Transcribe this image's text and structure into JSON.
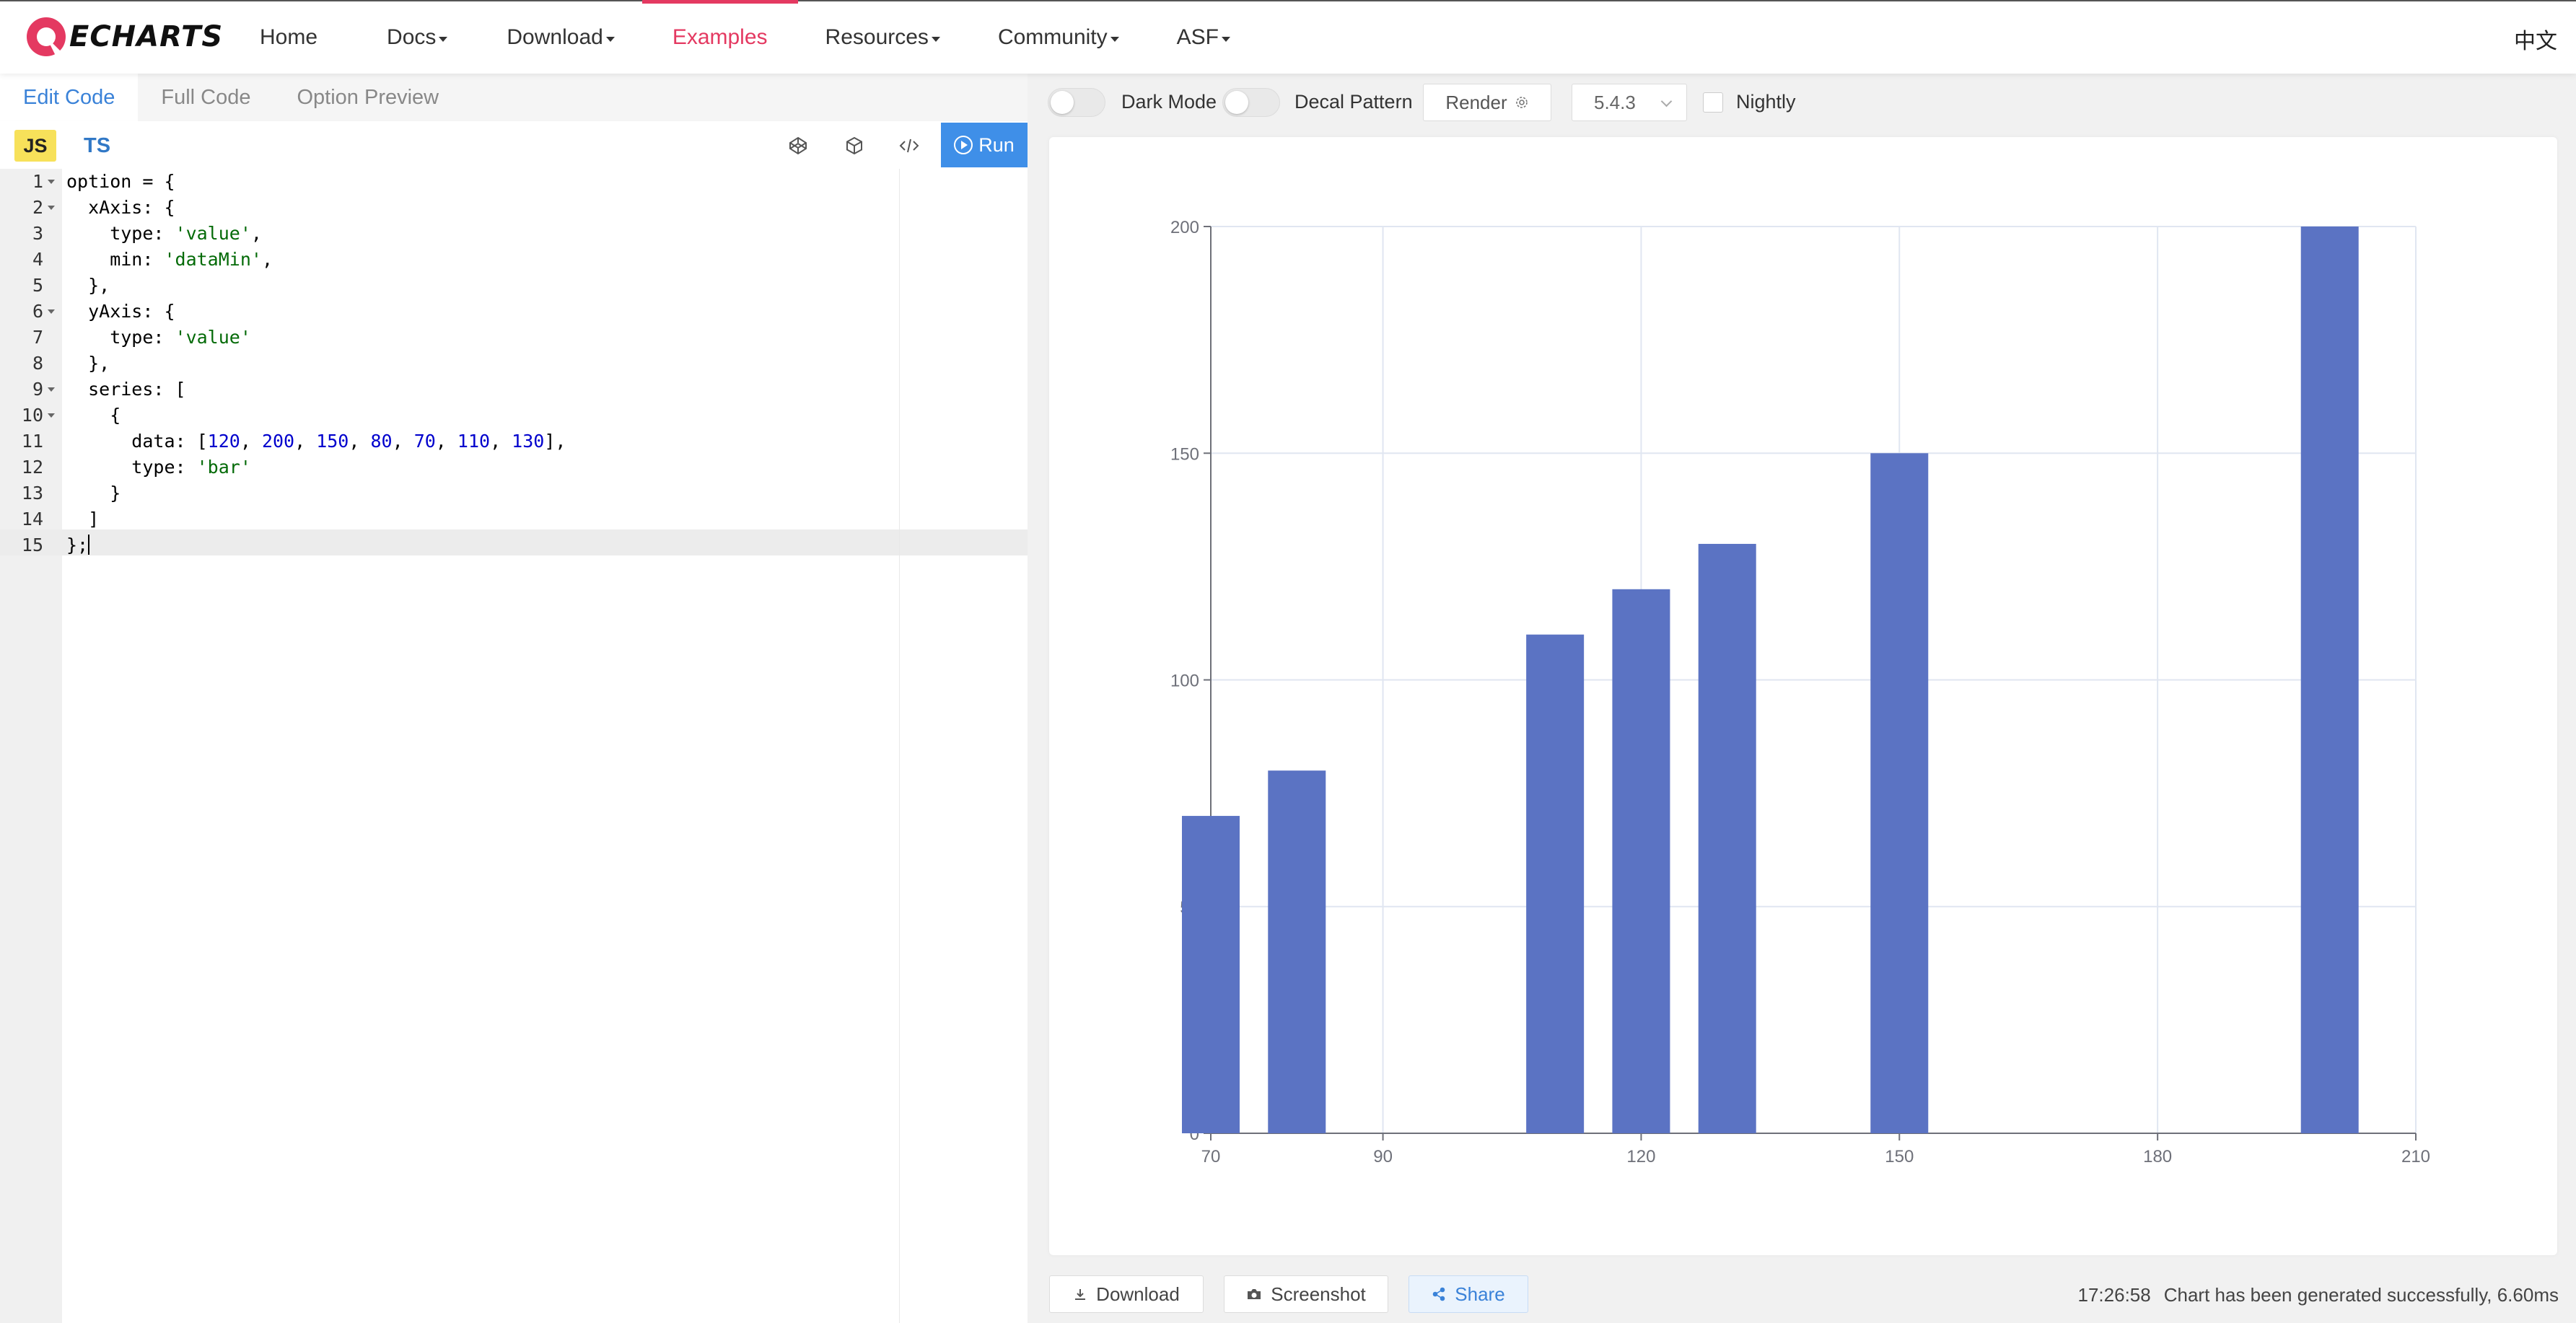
{
  "navbar": {
    "logo_text": "ECHARTS",
    "items": [
      {
        "label": "Home",
        "has_caret": false
      },
      {
        "label": "Docs",
        "has_caret": true
      },
      {
        "label": "Download",
        "has_caret": true
      },
      {
        "label": "Examples",
        "has_caret": false,
        "active": true
      },
      {
        "label": "Resources",
        "has_caret": true
      },
      {
        "label": "Community",
        "has_caret": true
      },
      {
        "label": "ASF",
        "has_caret": true
      }
    ],
    "language": "中文",
    "accent_color": "#e43961"
  },
  "editor": {
    "tabs": [
      "Edit Code",
      "Full Code",
      "Option Preview"
    ],
    "active_tab": "Edit Code",
    "lang_js": "JS",
    "lang_ts": "TS",
    "run_label": "Run",
    "tool_icons": [
      "codepen-icon",
      "codesandbox-icon",
      "code-embed-icon"
    ],
    "lines": [
      {
        "n": "1",
        "fold": true
      },
      {
        "n": "2",
        "fold": true
      },
      {
        "n": "3",
        "fold": false
      },
      {
        "n": "4",
        "fold": false
      },
      {
        "n": "5",
        "fold": false
      },
      {
        "n": "6",
        "fold": true
      },
      {
        "n": "7",
        "fold": false
      },
      {
        "n": "8",
        "fold": false
      },
      {
        "n": "9",
        "fold": true
      },
      {
        "n": "10",
        "fold": true
      },
      {
        "n": "11",
        "fold": false
      },
      {
        "n": "12",
        "fold": false
      },
      {
        "n": "13",
        "fold": false
      },
      {
        "n": "14",
        "fold": false
      },
      {
        "n": "15",
        "fold": false
      }
    ],
    "code": [
      [
        {
          "t": "option = {",
          "c": ""
        }
      ],
      [
        {
          "t": "  xAxis: {",
          "c": ""
        }
      ],
      [
        {
          "t": "    type: ",
          "c": ""
        },
        {
          "t": "'value'",
          "c": "s"
        },
        {
          "t": ",",
          "c": ""
        }
      ],
      [
        {
          "t": "    min: ",
          "c": ""
        },
        {
          "t": "'dataMin'",
          "c": "s"
        },
        {
          "t": ",",
          "c": ""
        }
      ],
      [
        {
          "t": "  },",
          "c": ""
        }
      ],
      [
        {
          "t": "  yAxis: {",
          "c": ""
        }
      ],
      [
        {
          "t": "    type: ",
          "c": ""
        },
        {
          "t": "'value'",
          "c": "s"
        }
      ],
      [
        {
          "t": "  },",
          "c": ""
        }
      ],
      [
        {
          "t": "  series: [",
          "c": ""
        }
      ],
      [
        {
          "t": "    {",
          "c": ""
        }
      ],
      [
        {
          "t": "      data: [",
          "c": ""
        },
        {
          "t": "120",
          "c": "n"
        },
        {
          "t": ", ",
          "c": ""
        },
        {
          "t": "200",
          "c": "n"
        },
        {
          "t": ", ",
          "c": ""
        },
        {
          "t": "150",
          "c": "n"
        },
        {
          "t": ", ",
          "c": ""
        },
        {
          "t": "80",
          "c": "n"
        },
        {
          "t": ", ",
          "c": ""
        },
        {
          "t": "70",
          "c": "n"
        },
        {
          "t": ", ",
          "c": ""
        },
        {
          "t": "110",
          "c": "n"
        },
        {
          "t": ", ",
          "c": ""
        },
        {
          "t": "130",
          "c": "n"
        },
        {
          "t": "],",
          "c": ""
        }
      ],
      [
        {
          "t": "      type: ",
          "c": ""
        },
        {
          "t": "'bar'",
          "c": "s"
        }
      ],
      [
        {
          "t": "    }",
          "c": ""
        }
      ],
      [
        {
          "t": "  ]",
          "c": ""
        }
      ],
      [
        {
          "t": "};",
          "c": ""
        }
      ]
    ]
  },
  "toolbar": {
    "dark_mode_label": "Dark Mode",
    "decal_label": "Decal Pattern",
    "render_label": "Render",
    "version": "5.4.3",
    "nightly_label": "Nightly"
  },
  "chart_data": {
    "type": "bar",
    "bar_color": "#5b73c3",
    "x": [
      120,
      200,
      150,
      80,
      70,
      110,
      130
    ],
    "values": [
      120,
      200,
      150,
      80,
      70,
      110,
      130
    ],
    "xlim": [
      70,
      210
    ],
    "ylim": [
      0,
      200
    ],
    "x_ticks": [
      "70",
      "90",
      "120",
      "150",
      "180",
      "210"
    ],
    "y_ticks": [
      "0",
      "50",
      "100",
      "150",
      "200"
    ],
    "grid": true
  },
  "bottom": {
    "download_label": "Download",
    "screenshot_label": "Screenshot",
    "share_label": "Share",
    "time": "17:26:58",
    "status": "Chart has been generated successfully, 6.60ms"
  }
}
